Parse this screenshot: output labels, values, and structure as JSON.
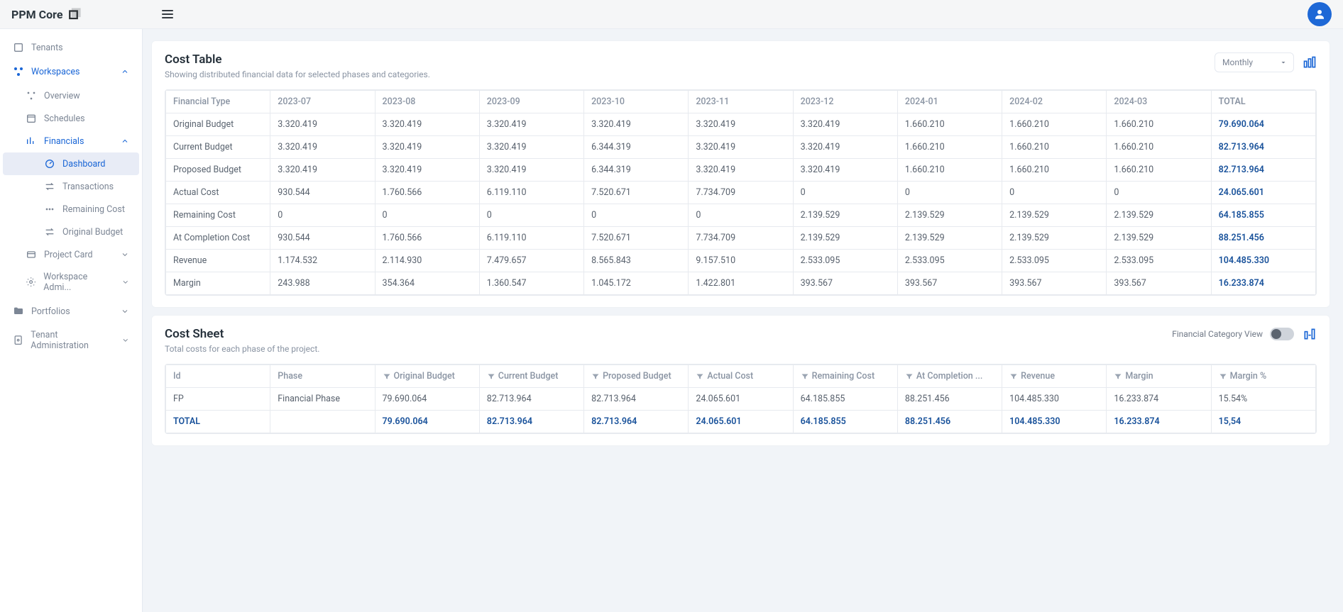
{
  "brand": {
    "name": "PPM Core"
  },
  "sidebar": {
    "items": [
      {
        "label": "Tenants"
      },
      {
        "label": "Workspaces"
      },
      {
        "label": "Overview"
      },
      {
        "label": "Schedules"
      },
      {
        "label": "Financials"
      },
      {
        "label": "Dashboard"
      },
      {
        "label": "Transactions"
      },
      {
        "label": "Remaining Cost"
      },
      {
        "label": "Original Budget"
      },
      {
        "label": "Project Card"
      },
      {
        "label": "Workspace Admi..."
      },
      {
        "label": "Portfolios"
      },
      {
        "label": "Tenant Administration"
      }
    ]
  },
  "cost_table": {
    "title": "Cost Table",
    "subtitle": "Showing distributed financial data for selected phases and categories.",
    "period_selector": "Monthly",
    "columns_label": "Financial Type",
    "total_label": "TOTAL",
    "columns": [
      "2023-07",
      "2023-08",
      "2023-09",
      "2023-10",
      "2023-11",
      "2023-12",
      "2024-01",
      "2024-02",
      "2024-03"
    ],
    "rows": [
      {
        "label": "Original Budget",
        "values": [
          "3.320.419",
          "3.320.419",
          "3.320.419",
          "3.320.419",
          "3.320.419",
          "3.320.419",
          "1.660.210",
          "1.660.210",
          "1.660.210"
        ],
        "total": "79.690.064"
      },
      {
        "label": "Current Budget",
        "values": [
          "3.320.419",
          "3.320.419",
          "3.320.419",
          "6.344.319",
          "3.320.419",
          "3.320.419",
          "1.660.210",
          "1.660.210",
          "1.660.210"
        ],
        "total": "82.713.964"
      },
      {
        "label": "Proposed Budget",
        "values": [
          "3.320.419",
          "3.320.419",
          "3.320.419",
          "6.344.319",
          "3.320.419",
          "3.320.419",
          "1.660.210",
          "1.660.210",
          "1.660.210"
        ],
        "total": "82.713.964"
      },
      {
        "label": "Actual Cost",
        "values": [
          "930.544",
          "1.760.566",
          "6.119.110",
          "7.520.671",
          "7.734.709",
          "0",
          "0",
          "0",
          "0"
        ],
        "total": "24.065.601"
      },
      {
        "label": "Remaining Cost",
        "values": [
          "0",
          "0",
          "0",
          "0",
          "0",
          "2.139.529",
          "2.139.529",
          "2.139.529",
          "2.139.529"
        ],
        "total": "64.185.855"
      },
      {
        "label": "At Completion Cost",
        "values": [
          "930.544",
          "1.760.566",
          "6.119.110",
          "7.520.671",
          "7.734.709",
          "2.139.529",
          "2.139.529",
          "2.139.529",
          "2.139.529"
        ],
        "total": "88.251.456"
      },
      {
        "label": "Revenue",
        "values": [
          "1.174.532",
          "2.114.930",
          "7.479.657",
          "8.565.843",
          "9.157.510",
          "2.533.095",
          "2.533.095",
          "2.533.095",
          "2.533.095"
        ],
        "total": "104.485.330"
      },
      {
        "label": "Margin",
        "values": [
          "243.988",
          "354.364",
          "1.360.547",
          "1.045.172",
          "1.422.801",
          "393.567",
          "393.567",
          "393.567",
          "393.567"
        ],
        "total": "16.233.874"
      }
    ]
  },
  "cost_sheet": {
    "title": "Cost Sheet",
    "subtitle": "Total costs for each phase of the project.",
    "toggle_label": "Financial Category View",
    "columns": [
      "Id",
      "Phase",
      "Original Budget",
      "Current Budget",
      "Proposed Budget",
      "Actual Cost",
      "Remaining Cost",
      "At Completion ...",
      "Revenue",
      "Margin",
      "Margin %"
    ],
    "rows": [
      {
        "id": "FP",
        "phase": "Financial Phase",
        "values": [
          "79.690.064",
          "82.713.964",
          "82.713.964",
          "24.065.601",
          "64.185.855",
          "88.251.456",
          "104.485.330",
          "16.233.874",
          "15.54%"
        ]
      }
    ],
    "total_row": {
      "id": "TOTAL",
      "phase": "",
      "values": [
        "79.690.064",
        "82.713.964",
        "82.713.964",
        "24.065.601",
        "64.185.855",
        "88.251.456",
        "104.485.330",
        "16.233.874",
        "15,54"
      ]
    }
  }
}
